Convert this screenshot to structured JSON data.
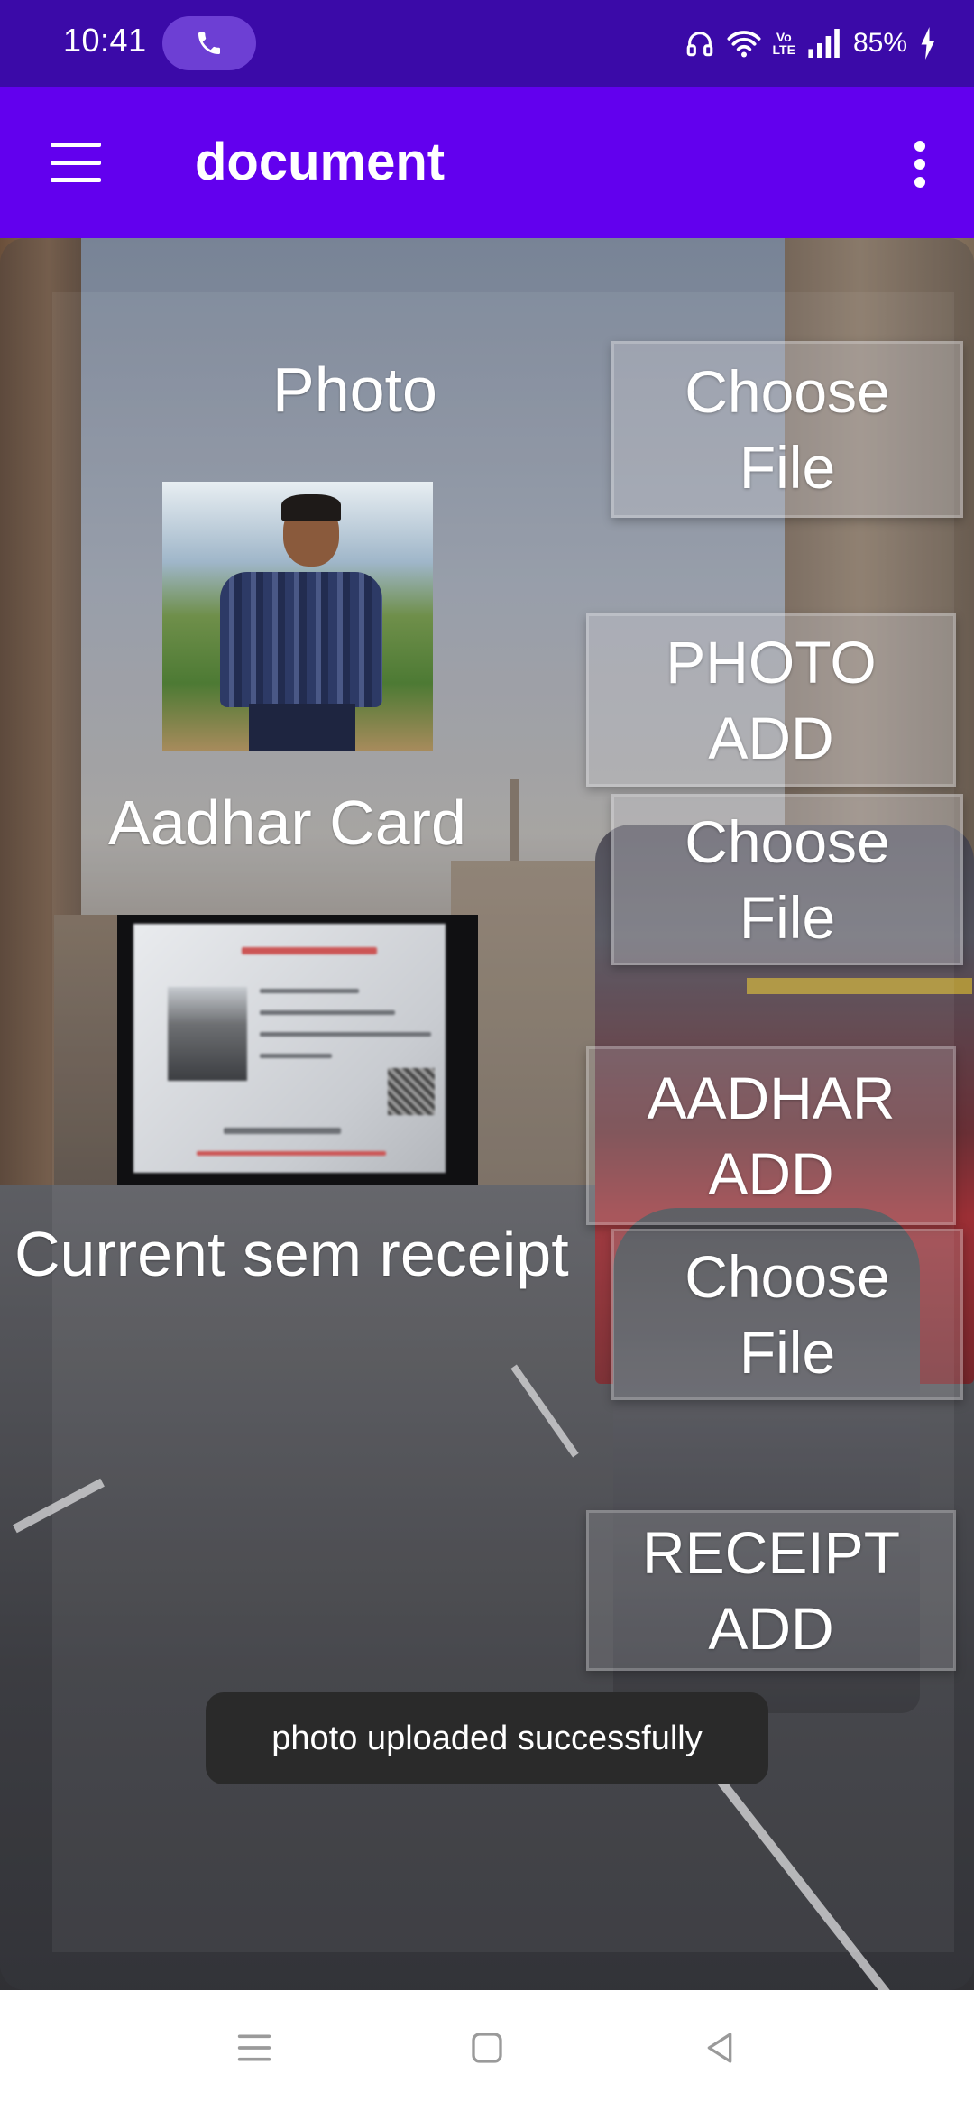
{
  "status_bar": {
    "time": "10:41",
    "call_icon": "phone-icon",
    "battery": "85%",
    "volte": "Vo\nLTE",
    "icons": [
      "headset-icon",
      "wifi-icon",
      "volte-icon",
      "signal-icon",
      "battery-charging-icon"
    ]
  },
  "app_bar": {
    "title": "document",
    "menu_icon": "hamburger-menu-icon",
    "overflow_icon": "more-vert-icon",
    "color": "#6200ee"
  },
  "form": {
    "photo_label": "Photo",
    "choose_photo_button": "Choose\nFile",
    "photo_add_button": "PHOTO\nADD",
    "aadhar_label": "Aadhar Card",
    "choose_aadhar_button": "Choose\nFile",
    "aadhar_add_button": "AADHAR\nADD",
    "receipt_label": "Current sem receipt",
    "choose_receipt_button": "Choose\nFile",
    "receipt_add_button": "RECEIPT\nADD"
  },
  "toast": {
    "message": "photo uploaded successfully"
  },
  "nav_bar": {
    "icons": [
      "recents-icon",
      "home-icon",
      "back-icon"
    ]
  },
  "colors": {
    "status_bar": "#3b0aa8",
    "app_bar": "#6200ee",
    "toast_bg": "#2a2a2a"
  }
}
